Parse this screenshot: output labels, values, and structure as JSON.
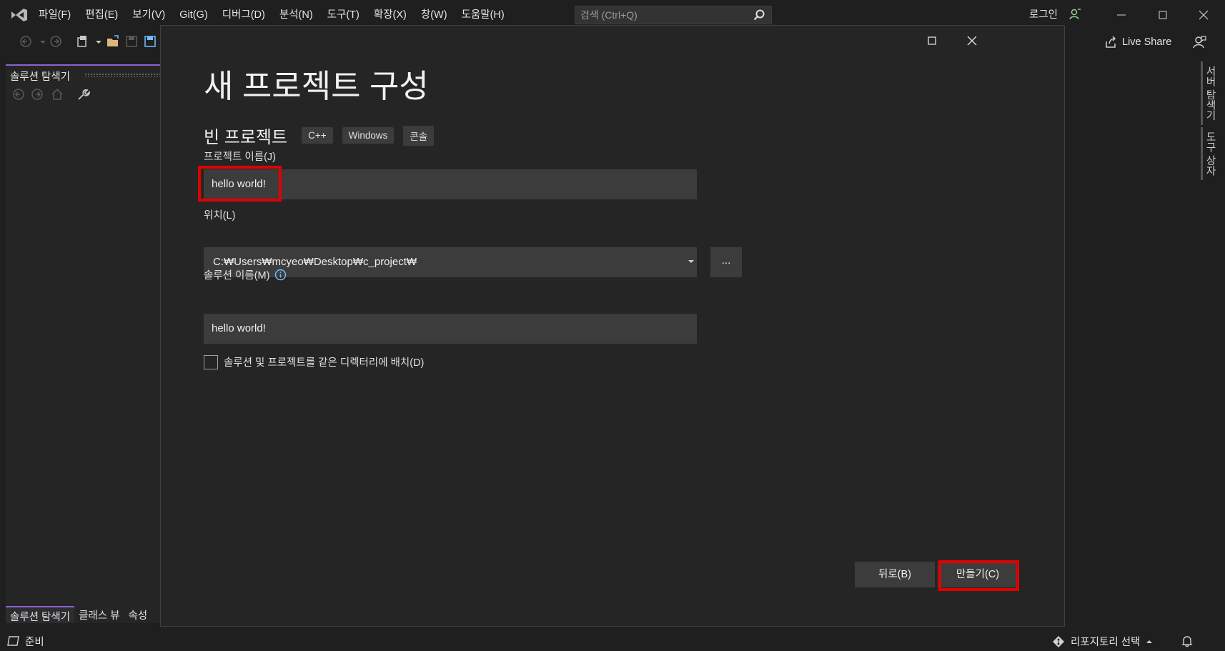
{
  "menu": {
    "items": [
      "파일(F)",
      "편집(E)",
      "보기(V)",
      "Git(G)",
      "디버그(D)",
      "분석(N)",
      "도구(T)",
      "확장(X)",
      "창(W)",
      "도움말(H)"
    ],
    "search_placeholder": "검색 (Ctrl+Q)",
    "login": "로그인"
  },
  "toolbar": {
    "live_share": "Live Share"
  },
  "left_panel": {
    "title": "솔루션 탐색기",
    "bottom_tabs": [
      "솔루션 탐색기",
      "클래스 뷰",
      "속성"
    ]
  },
  "right_tabs": [
    "서버 탐색기",
    "도구 상자"
  ],
  "status": {
    "ready": "준비",
    "repo": "리포지토리 선택"
  },
  "dialog": {
    "title": "새 프로젝트 구성",
    "template_name": "빈 프로젝트",
    "tags": [
      "C++",
      "Windows",
      "콘솔"
    ],
    "project_name_label": "프로젝트 이름(J)",
    "project_name_value": "hello world!",
    "location_label": "위치(L)",
    "location_value": "C:₩Users₩mcyeo₩Desktop₩c_project₩",
    "browse_label": "...",
    "solution_name_label": "솔루션 이름(M)",
    "solution_name_value": "hello world!",
    "same_dir_label": "솔루션 및 프로젝트를 같은 디렉터리에 배치(D)",
    "same_dir_checked": false,
    "back_label": "뒤로(B)",
    "create_label": "만들기(C)"
  },
  "colors": {
    "highlight": "#e00000",
    "accent": "#8a63d2",
    "info": "#75beff"
  }
}
